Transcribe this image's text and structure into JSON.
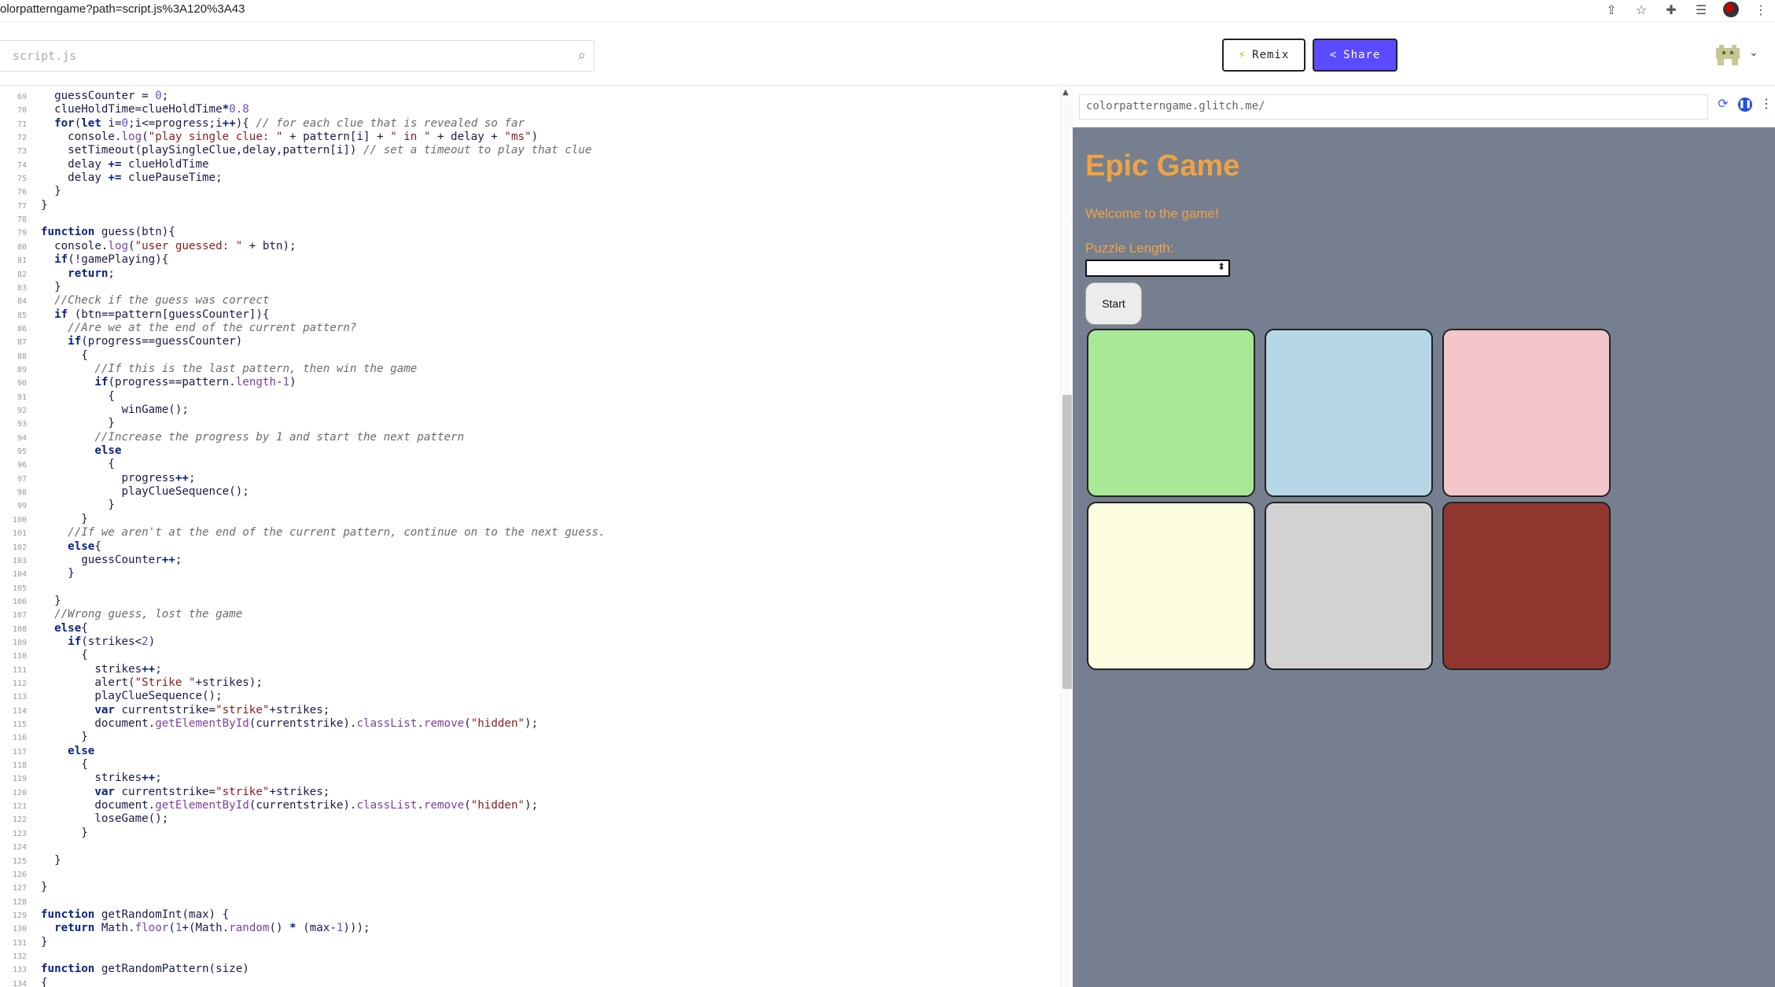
{
  "browser": {
    "url": "olorpatterngame?path=script.js%3A120%3A43",
    "icons": [
      "share-icon",
      "star-icon",
      "extensions-icon",
      "reading-list-icon",
      "avatar",
      "menu-icon"
    ]
  },
  "toolbar": {
    "file_name": "script.js",
    "remix_label": "Remix",
    "share_label": "Share"
  },
  "editor": {
    "lines": [
      {
        "n": "69",
        "code": "  guessCounter = 0;"
      },
      {
        "n": "70",
        "code": "  clueHoldTime=clueHoldTime*0.8"
      },
      {
        "n": "71",
        "code": "  for(let i=0;i<=progress;i++){ // for each clue that is revealed so far"
      },
      {
        "n": "72",
        "code": "    console.log(\"play single clue: \" + pattern[i] + \" in \" + delay + \"ms\")"
      },
      {
        "n": "73",
        "code": "    setTimeout(playSingleClue,delay,pattern[i]) // set a timeout to play that clue"
      },
      {
        "n": "74",
        "code": "    delay += clueHoldTime"
      },
      {
        "n": "75",
        "code": "    delay += cluePauseTime;"
      },
      {
        "n": "76",
        "code": "  }"
      },
      {
        "n": "77",
        "code": "}"
      },
      {
        "n": "78",
        "code": ""
      },
      {
        "n": "79",
        "code": "function guess(btn){"
      },
      {
        "n": "80",
        "code": "  console.log(\"user guessed: \" + btn);"
      },
      {
        "n": "81",
        "code": "  if(!gamePlaying){"
      },
      {
        "n": "82",
        "code": "    return;"
      },
      {
        "n": "83",
        "code": "  }"
      },
      {
        "n": "84",
        "code": "  //Check if the guess was correct"
      },
      {
        "n": "85",
        "code": "  if (btn==pattern[guessCounter]){"
      },
      {
        "n": "86",
        "code": "    //Are we at the end of the current pattern?"
      },
      {
        "n": "87",
        "code": "    if(progress==guessCounter)"
      },
      {
        "n": "88",
        "code": "      {"
      },
      {
        "n": "89",
        "code": "        //If this is the last pattern, then win the game"
      },
      {
        "n": "90",
        "code": "        if(progress==pattern.length-1)"
      },
      {
        "n": "91",
        "code": "          {"
      },
      {
        "n": "92",
        "code": "            winGame();"
      },
      {
        "n": "93",
        "code": "          }"
      },
      {
        "n": "94",
        "code": "        //Increase the progress by 1 and start the next pattern"
      },
      {
        "n": "95",
        "code": "        else"
      },
      {
        "n": "96",
        "code": "          {"
      },
      {
        "n": "97",
        "code": "            progress++;"
      },
      {
        "n": "98",
        "code": "            playClueSequence();"
      },
      {
        "n": "99",
        "code": "          }"
      },
      {
        "n": "100",
        "code": "      }"
      },
      {
        "n": "101",
        "code": "    //If we aren't at the end of the current pattern, continue on to the next guess."
      },
      {
        "n": "102",
        "code": "    else{"
      },
      {
        "n": "103",
        "code": "      guessCounter++;"
      },
      {
        "n": "104",
        "code": "    }"
      },
      {
        "n": "105",
        "code": ""
      },
      {
        "n": "106",
        "code": "  }"
      },
      {
        "n": "107",
        "code": "  //Wrong guess, lost the game"
      },
      {
        "n": "108",
        "code": "  else{"
      },
      {
        "n": "109",
        "code": "    if(strikes<2)"
      },
      {
        "n": "110",
        "code": "      {"
      },
      {
        "n": "111",
        "code": "        strikes++;"
      },
      {
        "n": "112",
        "code": "        alert(\"Strike \"+strikes);"
      },
      {
        "n": "113",
        "code": "        playClueSequence();"
      },
      {
        "n": "114",
        "code": "        var currentstrike=\"strike\"+strikes;"
      },
      {
        "n": "115",
        "code": "        document.getElementById(currentstrike).classList.remove(\"hidden\");"
      },
      {
        "n": "116",
        "code": "      }"
      },
      {
        "n": "117",
        "code": "    else"
      },
      {
        "n": "118",
        "code": "      {"
      },
      {
        "n": "119",
        "code": "        strikes++;"
      },
      {
        "n": "120",
        "code": "        var currentstrike=\"strike\"+strikes;"
      },
      {
        "n": "121",
        "code": "        document.getElementById(currentstrike).classList.remove(\"hidden\");"
      },
      {
        "n": "122",
        "code": "        loseGame();"
      },
      {
        "n": "123",
        "code": "      }"
      },
      {
        "n": "124",
        "code": ""
      },
      {
        "n": "125",
        "code": "  }"
      },
      {
        "n": "126",
        "code": ""
      },
      {
        "n": "127",
        "code": "}"
      },
      {
        "n": "128",
        "code": ""
      },
      {
        "n": "129",
        "code": "function getRandomInt(max) {"
      },
      {
        "n": "130",
        "code": "  return Math.floor(1+(Math.random() * (max-1)));"
      },
      {
        "n": "131",
        "code": "}"
      },
      {
        "n": "132",
        "code": ""
      },
      {
        "n": "133",
        "code": "function getRandomPattern(size)"
      },
      {
        "n": "134",
        "code": "{"
      }
    ]
  },
  "preview": {
    "url": "colorpatterngame.glitch.me/",
    "game": {
      "title": "Epic Game",
      "welcome": "Welcome to the game!",
      "length_label": "Puzzle Length:",
      "length_value": "",
      "start_label": "Start",
      "pads": [
        {
          "color": "#a8e896"
        },
        {
          "color": "#b6d7e6"
        },
        {
          "color": "#f3c6cc"
        },
        {
          "color": "#fdfde2"
        },
        {
          "color": "#d2d2d2"
        },
        {
          "color": "#91362e"
        }
      ]
    }
  }
}
